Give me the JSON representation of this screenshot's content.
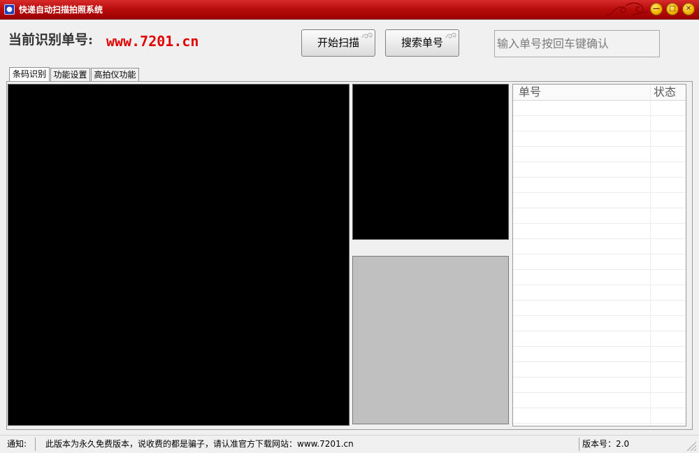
{
  "window": {
    "title": "快递自动扫描拍照系统",
    "icon": "app-user-icon",
    "controls": {
      "minimize_icon": "minimize-icon",
      "maximize_icon": "maximize-icon",
      "close_icon": "close-icon"
    },
    "colors": {
      "titlebar": "#b80c0c",
      "control_button": "#f4b400"
    }
  },
  "header": {
    "current_label": "当前识别单号:",
    "current_value": "www.7201.cn",
    "current_value_color": "#e00000",
    "start_scan_label": "开始扫描",
    "search_label": "搜索单号",
    "search_input": {
      "value": "",
      "placeholder": "输入单号按回车键确认"
    }
  },
  "tabs": [
    {
      "label": "条码识别",
      "active": true
    },
    {
      "label": "功能设置",
      "active": false
    },
    {
      "label": "高拍仪功能",
      "active": false
    }
  ],
  "list": {
    "columns": [
      "单号",
      "状态"
    ],
    "rows": []
  },
  "statusbar": {
    "label": "通知:",
    "message": "此版本为永久免费版本，说收费的都是骗子，请认准官方下载网站：www.7201.cn",
    "version": "版本号：2.0"
  }
}
